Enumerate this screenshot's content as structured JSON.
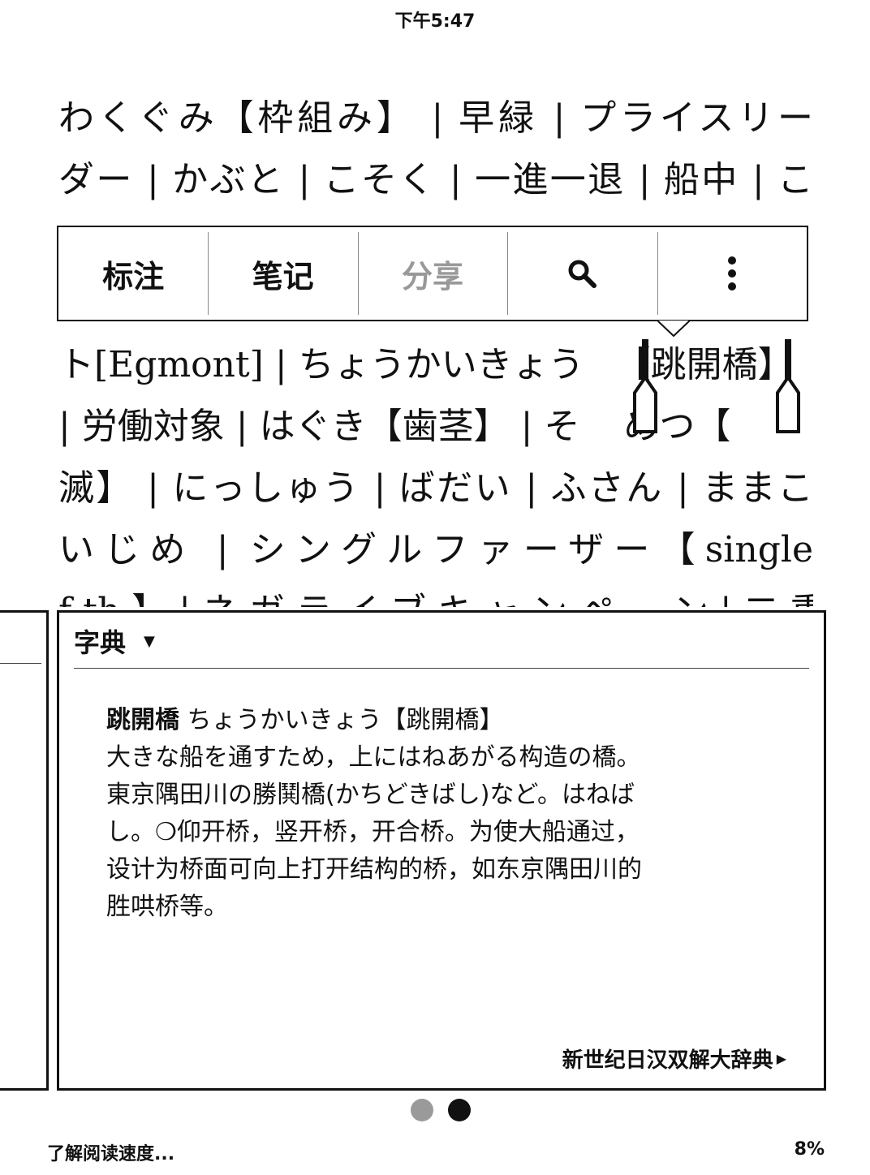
{
  "status": {
    "time": "下午5:47"
  },
  "reader": {
    "lines": [
      "わくぐみ【枠組み】 | 早緑 | プライスリー",
      "ダー | かぶと | こそく | 一進一退 | 船中 | こ",
      "",
      "",
      "ト[Egmont] | ちょうかいきょう",
      "| 労働対象 | はぐき【歯茎】 | そ",
      "滅】 | にっしゅう | ばだい | ふさん | ままこ",
      "いじめ | シングルファーザー【single",
      "f th  】 | ネ ガ ラ イ ブ キ ャ ン ペ ー ン | 二 重 |"
    ],
    "selected": "【跳開橋】",
    "after_handle_line6": "めつ【"
  },
  "toolbar": {
    "highlight": "标注",
    "note": "笔记",
    "share": "分享",
    "search_icon": "magnifier-icon",
    "more_icon": "vertical-ellipsis-icon"
  },
  "dictionary": {
    "title": "字典",
    "headword": "跳開橋",
    "reading": "ちょうかいきょう【跳開橋】",
    "definition_lines": [
      "大きな船を通すため，上にはねあがる构造の橋。",
      "東京隅田川の勝鬨橋(かちどきばし)など。はねば",
      "し。❍仰开桥，竖开桥，开合桥。为使大船通过，",
      "设计为桥面可向上打开结构的桥，如东京隅田川的",
      "胜哄桥等。"
    ],
    "source": "新世纪日汉双解大辞典"
  },
  "pager": {
    "count": 2,
    "active": 1
  },
  "footer": {
    "left": "了解阅读速度...",
    "progress": "8%"
  }
}
